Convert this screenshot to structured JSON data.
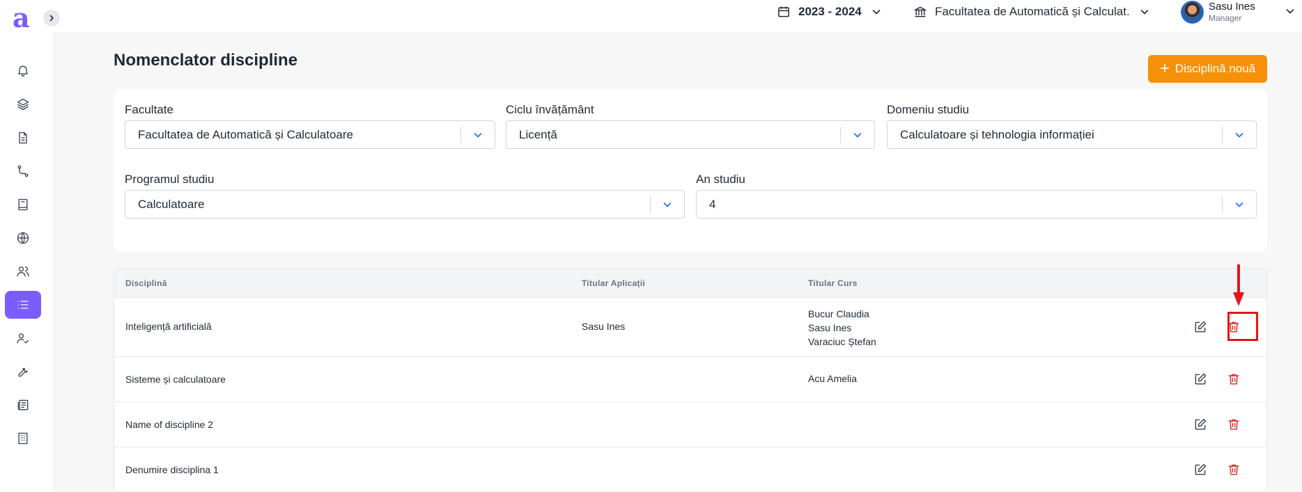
{
  "app": {
    "logo_letter": "a",
    "accent": "#7b5cff",
    "brand_orange": "#f79009"
  },
  "sidebar": {
    "items": [
      {
        "icon": "bell-icon",
        "active": false
      },
      {
        "icon": "layers-icon",
        "active": false
      },
      {
        "icon": "document-icon",
        "active": false
      },
      {
        "icon": "route-icon",
        "active": false
      },
      {
        "icon": "book-icon",
        "active": false
      },
      {
        "icon": "globe-icon",
        "active": false
      },
      {
        "icon": "users-icon",
        "active": false
      },
      {
        "icon": "list-icon",
        "active": true
      },
      {
        "icon": "user-check-icon",
        "active": false
      },
      {
        "icon": "wrench-icon",
        "active": false
      },
      {
        "icon": "newspaper-icon",
        "active": false
      },
      {
        "icon": "building-icon",
        "active": false
      }
    ]
  },
  "topbar": {
    "year": "2023 - 2024",
    "faculty": "Facultatea de Automatică și Calculat...",
    "user_name": "Sasu Ines",
    "user_role": "Manager"
  },
  "page": {
    "title": "Nomenclator discipline",
    "new_button": "Disciplină nouă"
  },
  "filters": {
    "faculty_label": "Facultate",
    "faculty_value": "Facultatea de Automatică și Calculatoare",
    "cycle_label": "Ciclu învățământ",
    "cycle_value": "Licență",
    "domain_label": "Domeniu studiu",
    "domain_value": "Calculatoare și tehnologia informației",
    "program_label": "Programul studiu",
    "program_value": "Calculatoare",
    "year_label": "An studiu",
    "year_value": "4"
  },
  "table": {
    "headers": {
      "discipline": "Disciplină",
      "app_holder": "Titular Aplicații",
      "course_holder": "Titular Curs"
    },
    "rows": [
      {
        "discipline": "Inteligență artificială",
        "app_holder": "Sasu Ines",
        "course_holders": [
          "Bucur Claudia",
          "Sasu Ines",
          "Varaciuc Ștefan"
        ]
      },
      {
        "discipline": "Sisteme și calculatoare",
        "app_holder": "",
        "course_holders": [
          "Acu Amelia"
        ]
      },
      {
        "discipline": "Name of discipline 2",
        "app_holder": "",
        "course_holders": []
      },
      {
        "discipline": "Denumire disciplina 1",
        "app_holder": "",
        "course_holders": []
      }
    ]
  }
}
